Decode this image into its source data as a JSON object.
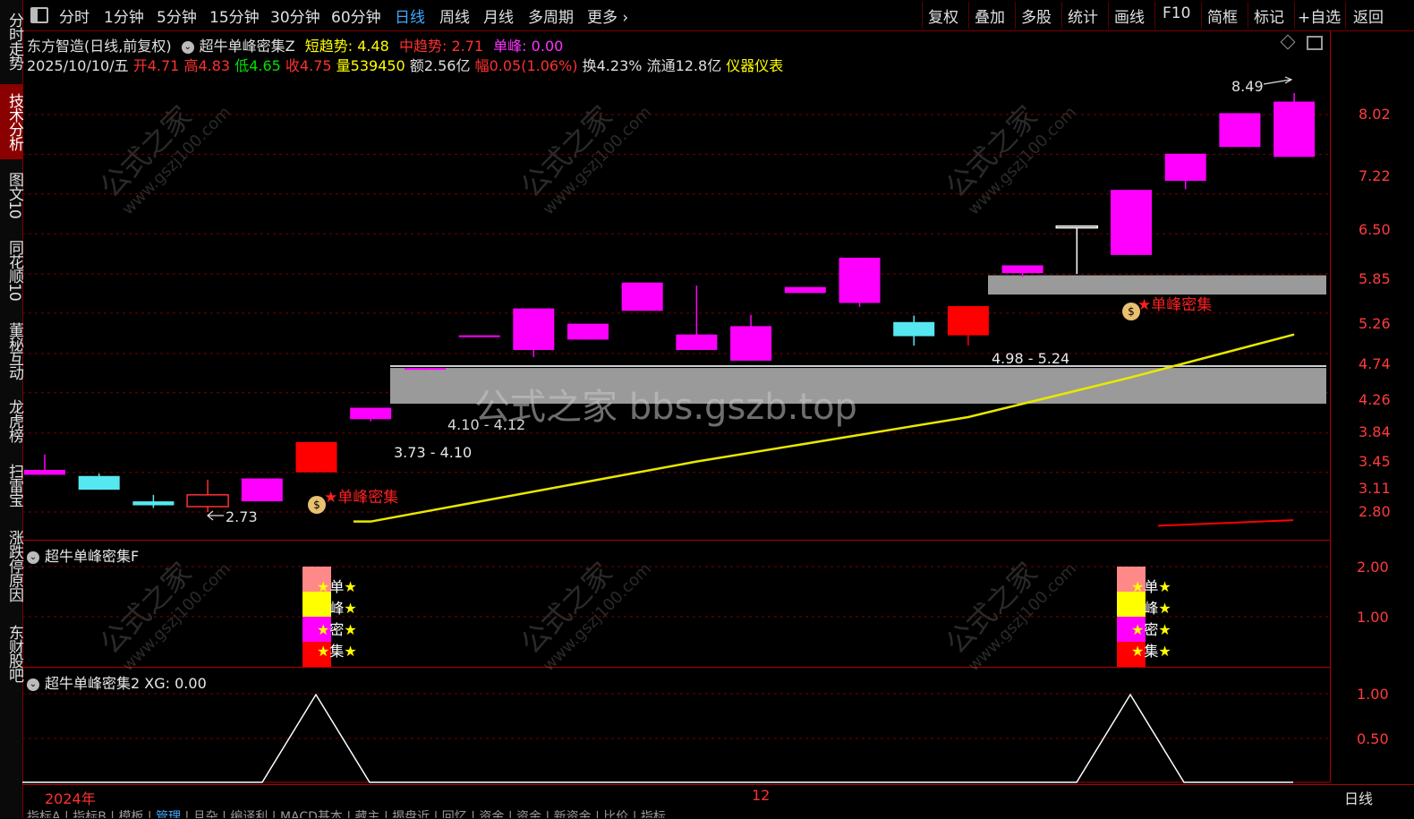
{
  "toolbar": {
    "left_items": [
      "分时",
      "1分钟",
      "5分钟",
      "15分钟",
      "30分钟",
      "60分钟",
      "日线",
      "周线",
      "月线",
      "多周期",
      "更多"
    ],
    "active": "日线",
    "right_items": [
      "复权",
      "叠加",
      "多股",
      "统计",
      "画线",
      "F10",
      "简框",
      "标记",
      "+自选",
      "返回"
    ]
  },
  "left_tabs": [
    "分时走势",
    "技术分析",
    "图文10",
    "同花顺10",
    "董秘互动",
    "龙虎榜",
    "扫雷宝",
    "涨跌停原因",
    "东财股吧"
  ],
  "header": {
    "stock": "东方智造(日线,前复权)",
    "indicator": "超牛单峰密集Z",
    "short_trend_label": "短趋势:",
    "short_trend_value": "4.48",
    "mid_trend_label": "中趋势:",
    "mid_trend_value": "2.71",
    "peak_label": "单峰:",
    "peak_value": "0.00"
  },
  "quote": {
    "date": "2025/10/10/五",
    "open": "开4.71",
    "high": "高4.83",
    "low": "低4.65",
    "close": "收4.75",
    "volume": "量539450",
    "amount": "额2.56亿",
    "change": "幅0.05(1.06%)",
    "turnover": "换4.23%",
    "float": "流通12.8亿",
    "industry": "仪器仪表"
  },
  "price_axis": [
    "8.02",
    "7.22",
    "6.50",
    "5.85",
    "5.26",
    "4.74",
    "4.26",
    "3.84",
    "3.45",
    "3.11",
    "2.80"
  ],
  "panel2_axis": [
    "2.00",
    "1.00"
  ],
  "panel3_axis": [
    "1.00",
    "0.50"
  ],
  "main_annotations": {
    "max_label": "8.49",
    "min_label": "2.73",
    "zone1_label": "3.73 - 4.10",
    "zone2_label": "4.10 - 4.12",
    "zone3_label": "4.98 - 5.24",
    "signal_text": "单峰密集",
    "watermark_center": "公式之家 bbs.gszb.top"
  },
  "watermark": {
    "main": "公式之家",
    "sub": "www.gszj100.com"
  },
  "panel2": {
    "title": "超牛单峰密集F",
    "labels": [
      "单",
      "峰",
      "密",
      "集"
    ]
  },
  "panel3": {
    "title": "超牛单峰密集2",
    "xg_label": "XG:",
    "xg_value": "0.00"
  },
  "time_axis": {
    "start": "2024年",
    "mid": "12",
    "period": "日线"
  },
  "bottom_tabs": [
    "指标A",
    "指标B",
    "模板",
    "管理",
    "且杂",
    "编译利",
    "MACD基本",
    "藏主",
    "揭盘近",
    "回忆",
    "资金",
    "资金",
    "新资金",
    "比价",
    "指标"
  ],
  "colors": {
    "up": "#ff00ff",
    "down": "#55e8f0",
    "up_red": "#ff0000",
    "yellow_line": "#e8e800",
    "grid_red": "#b00000"
  },
  "candles": [
    {
      "o": 3.09,
      "c": 3.13,
      "h": 3.26,
      "l": 3.09,
      "t": "up"
    },
    {
      "o": 3.08,
      "c": 2.97,
      "h": 3.1,
      "l": 2.97,
      "t": "down"
    },
    {
      "o": 2.88,
      "c": 2.85,
      "h": 2.93,
      "l": 2.83,
      "t": "down"
    },
    {
      "o": 2.84,
      "c": 2.93,
      "h": 3.05,
      "l": 2.8,
      "t": "hollow"
    },
    {
      "o": 2.88,
      "c": 3.06,
      "h": 3.06,
      "l": 2.88,
      "t": "up"
    },
    {
      "o": 3.11,
      "c": 3.37,
      "h": 3.37,
      "l": 3.11,
      "t": "red"
    },
    {
      "o": 3.58,
      "c": 3.69,
      "h": 3.69,
      "l": 3.56,
      "t": "up"
    },
    {
      "o": 4.08,
      "c": 4.1,
      "h": 4.1,
      "l": 4.08,
      "t": "up"
    },
    {
      "o": 4.46,
      "c": 4.47,
      "h": 4.47,
      "l": 4.46,
      "t": "up"
    },
    {
      "o": 4.3,
      "c": 4.8,
      "h": 4.8,
      "l": 4.22,
      "t": "up"
    },
    {
      "o": 4.42,
      "c": 4.61,
      "h": 4.61,
      "l": 4.42,
      "t": "up"
    },
    {
      "o": 4.77,
      "c": 5.14,
      "h": 5.14,
      "l": 4.77,
      "t": "up"
    },
    {
      "o": 4.3,
      "c": 4.48,
      "h": 5.1,
      "l": 4.3,
      "t": "up"
    },
    {
      "o": 4.18,
      "c": 4.58,
      "h": 4.72,
      "l": 4.18,
      "t": "up"
    },
    {
      "o": 5.0,
      "c": 5.08,
      "h": 5.08,
      "l": 5.0,
      "t": "up"
    },
    {
      "o": 4.87,
      "c": 5.49,
      "h": 5.49,
      "l": 4.82,
      "t": "up"
    },
    {
      "o": 4.63,
      "c": 4.46,
      "h": 4.71,
      "l": 4.35,
      "t": "down"
    },
    {
      "o": 4.47,
      "c": 4.83,
      "h": 4.83,
      "l": 4.35,
      "t": "red"
    },
    {
      "o": 5.27,
      "c": 5.38,
      "h": 5.38,
      "l": 5.22,
      "t": "up"
    },
    {
      "o": 5.97,
      "c": 5.97,
      "h": 5.97,
      "l": 5.26,
      "t": "hollow"
    },
    {
      "o": 5.53,
      "c": 6.57,
      "h": 6.57,
      "l": 5.53,
      "t": "up"
    },
    {
      "o": 6.73,
      "c": 7.23,
      "h": 7.23,
      "l": 6.58,
      "t": "up"
    },
    {
      "o": 7.36,
      "c": 8.05,
      "h": 8.05,
      "l": 7.36,
      "t": "up"
    },
    {
      "o": 7.17,
      "c": 8.3,
      "h": 8.49,
      "l": 7.17,
      "t": "up"
    }
  ],
  "ma_line": [
    {
      "i": 6,
      "v": 2.73
    },
    {
      "i": 12,
      "v": 3.2
    },
    {
      "i": 17,
      "v": 3.6
    },
    {
      "i": 20,
      "v": 4.0
    },
    {
      "i": 23,
      "v": 4.48
    }
  ]
}
